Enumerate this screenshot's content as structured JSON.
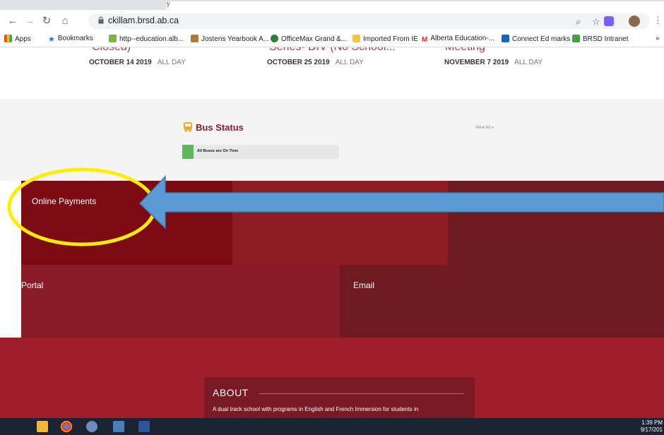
{
  "browser": {
    "tab_partial": "y",
    "url": "ckillam.brsd.ab.ca",
    "bookmarks": [
      "Apps",
      "Bookmarks",
      "http--education.alb...",
      "Jostens Yearbook A...",
      "OfficeMax Grand &...",
      "Imported From IE",
      "Alberta Education-...",
      "Connect Ed marks",
      "BRSD Intranet"
    ],
    "overflow": "»"
  },
  "events": [
    {
      "title": "Closed)",
      "date": "OCTOBER 14 2019",
      "time": "ALL DAY"
    },
    {
      "title": "Series- DIV (No School...",
      "date": "OCTOBER 25 2019",
      "time": "ALL DAY"
    },
    {
      "title": "Meeting",
      "date": "NOVEMBER 7 2019",
      "time": "ALL DAY"
    }
  ],
  "bus": {
    "title": "Bus Status",
    "view_all": "View All »",
    "status": "All Buses are On Time"
  },
  "tiles": {
    "online_payments": "Online Payments",
    "portal": "Portal",
    "email": "Email"
  },
  "about": {
    "title": "ABOUT",
    "text": "A dual track school with programs in English and French Immersion for students in"
  },
  "taskbar": {
    "time": "1:39 PM",
    "date": "9/17/201"
  },
  "colors": {
    "tile_dark": "#7e0a13",
    "tile_mid": "#8b1b24",
    "tile_red": "#9d1f2b",
    "annotation_circle": "#ffee00",
    "annotation_arrow": "#5b9bd5"
  }
}
